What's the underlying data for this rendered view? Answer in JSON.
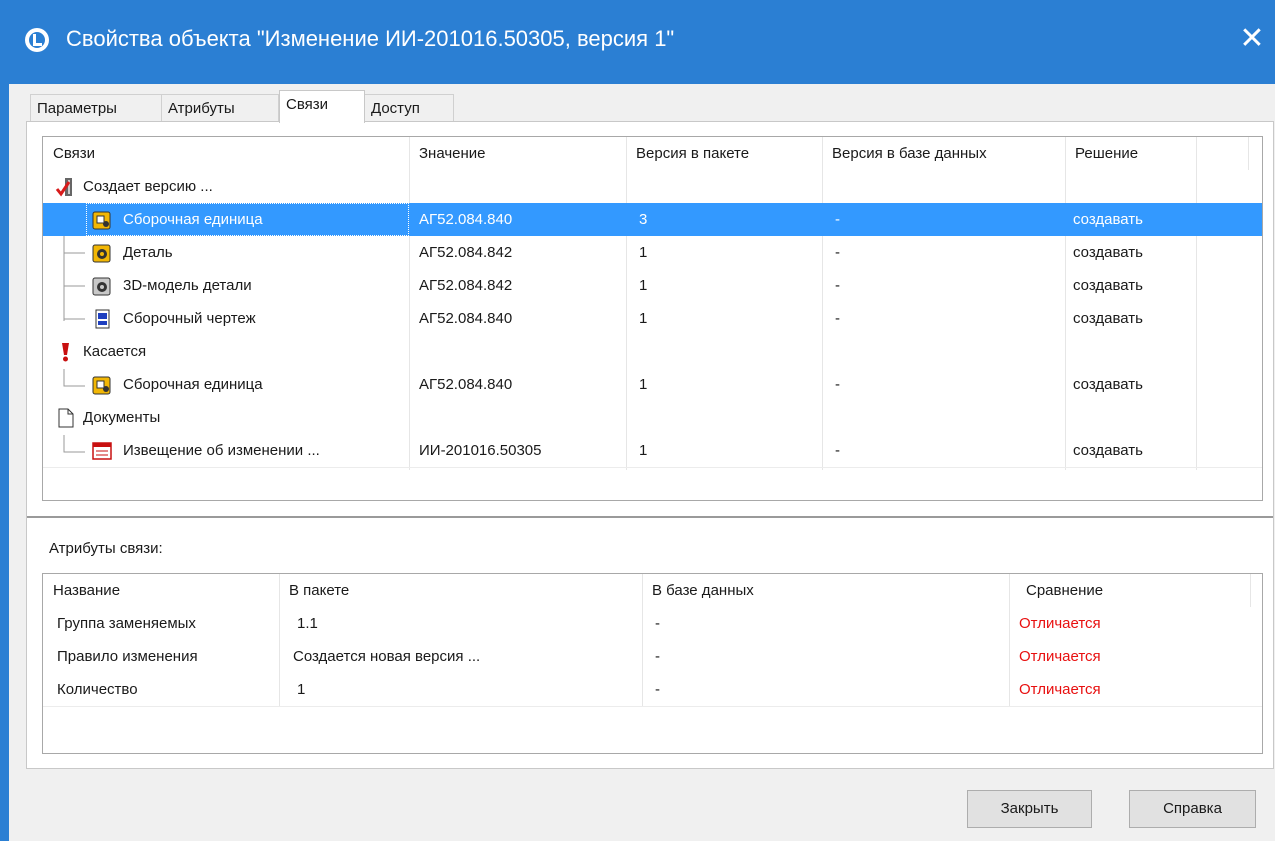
{
  "window": {
    "title": "Свойства объекта \"Изменение ИИ-201016.50305, версия 1\"",
    "close_glyph": "✕",
    "accent": "#2b7fd3"
  },
  "tabs": [
    {
      "label": "Параметры"
    },
    {
      "label": "Атрибуты"
    },
    {
      "label": "Связи"
    },
    {
      "label": "Доступ"
    }
  ],
  "links_table": {
    "columns": [
      "Связи",
      "Значение",
      "Версия в пакете",
      "Версия в базе данных",
      "Решение"
    ],
    "rows": [
      {
        "name": "Создает версию ...",
        "icon": "create-version-icon",
        "value": "",
        "pkg": "",
        "db": "",
        "decision": ""
      },
      {
        "name": "Сборочная единица",
        "icon": "assembly-icon",
        "value": "АГ52.084.840",
        "pkg": "3",
        "db": "-",
        "decision": "создавать"
      },
      {
        "name": "Деталь",
        "icon": "part-icon",
        "value": "АГ52.084.842",
        "pkg": "1",
        "db": "-",
        "decision": "создавать"
      },
      {
        "name": "3D-модель детали",
        "icon": "3d-model-icon",
        "value": "АГ52.084.842",
        "pkg": "1",
        "db": "-",
        "decision": "создавать"
      },
      {
        "name": "Сборочный чертеж",
        "icon": "drawing-icon",
        "value": "АГ52.084.840",
        "pkg": "1",
        "db": "-",
        "decision": "создавать"
      },
      {
        "name": "Касается",
        "icon": "concerns-icon",
        "value": "",
        "pkg": "",
        "db": "",
        "decision": ""
      },
      {
        "name": "Сборочная единица",
        "icon": "assembly-icon",
        "value": "АГ52.084.840",
        "pkg": "1",
        "db": "-",
        "decision": "создавать"
      },
      {
        "name": "Документы",
        "icon": "document-icon",
        "value": "",
        "pkg": "",
        "db": "",
        "decision": ""
      },
      {
        "name": "Извещение об изменении ...",
        "icon": "change-notice-icon",
        "value": "ИИ-201016.50305",
        "pkg": "1",
        "db": "-",
        "decision": "создавать"
      }
    ]
  },
  "attributes": {
    "caption": "Атрибуты связи:",
    "columns": [
      "Название",
      "В пакете",
      "В базе данных",
      "Сравнение"
    ],
    "rows": [
      {
        "name": "Группа заменяемых",
        "pkg": "1.1",
        "db": "-",
        "compare": "Отличается"
      },
      {
        "name": "Правило изменения",
        "pkg": "Создается новая версия ...",
        "db": "-",
        "compare": "Отличается"
      },
      {
        "name": "Количество",
        "pkg": "1",
        "db": "-",
        "compare": "Отличается"
      }
    ],
    "diff_color": "#e81010"
  },
  "buttons": {
    "close": "Закрыть",
    "help": "Справка"
  }
}
